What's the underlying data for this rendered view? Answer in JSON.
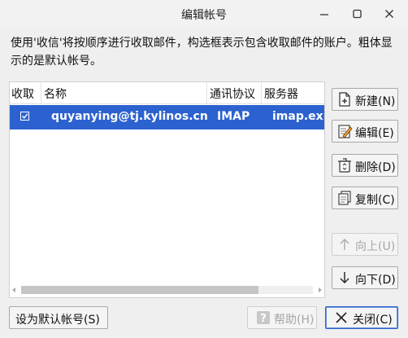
{
  "window": {
    "title": "编辑帐号"
  },
  "description": "使用'收信'将按顺序进行收取邮件，构选框表示包含收取邮件的账户。粗体显示的是默认帐号。",
  "table": {
    "columns": [
      "收取",
      "名称",
      "通讯协议",
      "服务器"
    ],
    "rows": [
      {
        "checked": true,
        "name": "quyanying@tj.kylinos.cn",
        "protocol": "IMAP",
        "server": "imap.exm"
      }
    ]
  },
  "side_buttons": {
    "new": "新建(N)",
    "edit": "编辑(E)",
    "delete": "删除(D)",
    "copy": "复制(C)",
    "up": "向上(U)",
    "down": "向下(D)"
  },
  "bottom_buttons": {
    "set_default": "设为默认帐号(S)",
    "help": "帮助(H)",
    "close": "关闭(C)"
  },
  "colors": {
    "selection": "#2c62cf"
  }
}
